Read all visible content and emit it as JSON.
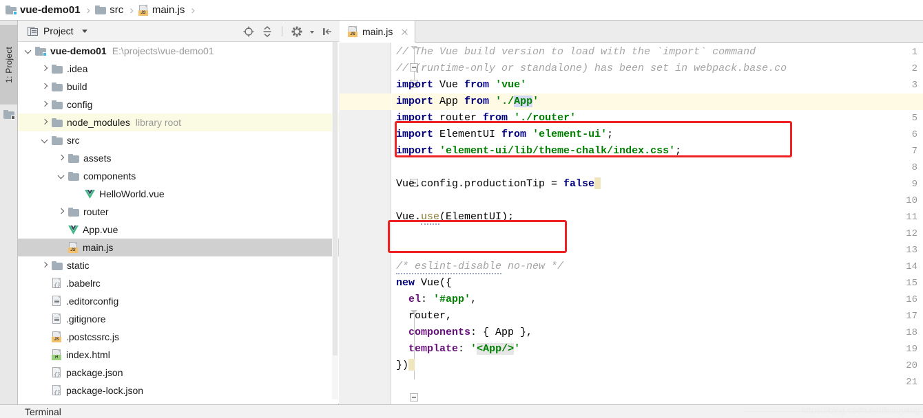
{
  "breadcrumb": {
    "items": [
      {
        "label": "vue-demo01",
        "icon": "module-folder-icon",
        "bold": true
      },
      {
        "label": "src",
        "icon": "folder-icon",
        "bold": false
      },
      {
        "label": "main.js",
        "icon": "js-file-icon",
        "bold": false
      }
    ],
    "separator": "›"
  },
  "tool_strip": {
    "project_tab_label": "1: Project"
  },
  "project_panel": {
    "title": "Project",
    "toolbar": [
      {
        "name": "locate-target-icon",
        "tooltip": "Select Opened File"
      },
      {
        "name": "collapse-all-icon",
        "tooltip": "Collapse All"
      },
      {
        "name": "settings-gear-icon",
        "tooltip": "Settings"
      },
      {
        "name": "hide-panel-icon",
        "tooltip": "Hide"
      }
    ],
    "tree": [
      {
        "label": "vue-demo01",
        "note": "E:\\projects\\vue-demo01",
        "icon": "module-folder-icon",
        "indent": 0,
        "twisty": "down",
        "bold": true,
        "state": "normal"
      },
      {
        "label": ".idea",
        "note": "",
        "icon": "folder-icon",
        "indent": 1,
        "twisty": "right",
        "bold": false,
        "state": "normal"
      },
      {
        "label": "build",
        "note": "",
        "icon": "folder-icon",
        "indent": 1,
        "twisty": "right",
        "bold": false,
        "state": "normal"
      },
      {
        "label": "config",
        "note": "",
        "icon": "folder-icon",
        "indent": 1,
        "twisty": "right",
        "bold": false,
        "state": "normal"
      },
      {
        "label": "node_modules",
        "note": "library root",
        "icon": "folder-icon",
        "indent": 1,
        "twisty": "right",
        "bold": false,
        "state": "library"
      },
      {
        "label": "src",
        "note": "",
        "icon": "folder-icon",
        "indent": 1,
        "twisty": "down",
        "bold": false,
        "state": "normal"
      },
      {
        "label": "assets",
        "note": "",
        "icon": "folder-icon",
        "indent": 2,
        "twisty": "right",
        "bold": false,
        "state": "normal"
      },
      {
        "label": "components",
        "note": "",
        "icon": "folder-icon",
        "indent": 2,
        "twisty": "down",
        "bold": false,
        "state": "normal"
      },
      {
        "label": "HelloWorld.vue",
        "note": "",
        "icon": "vue-file-icon",
        "indent": 3,
        "twisty": "none",
        "bold": false,
        "state": "normal"
      },
      {
        "label": "router",
        "note": "",
        "icon": "folder-icon",
        "indent": 2,
        "twisty": "right",
        "bold": false,
        "state": "normal"
      },
      {
        "label": "App.vue",
        "note": "",
        "icon": "vue-file-icon",
        "indent": 2,
        "twisty": "none",
        "bold": false,
        "state": "normal"
      },
      {
        "label": "main.js",
        "note": "",
        "icon": "js-file-icon",
        "indent": 2,
        "twisty": "none",
        "bold": false,
        "state": "selected"
      },
      {
        "label": "static",
        "note": "",
        "icon": "folder-icon",
        "indent": 1,
        "twisty": "right",
        "bold": false,
        "state": "normal"
      },
      {
        "label": ".babelrc",
        "note": "",
        "icon": "json-file-icon",
        "indent": 1,
        "twisty": "none",
        "bold": false,
        "state": "normal"
      },
      {
        "label": ".editorconfig",
        "note": "",
        "icon": "text-file-icon",
        "indent": 1,
        "twisty": "none",
        "bold": false,
        "state": "normal"
      },
      {
        "label": ".gitignore",
        "note": "",
        "icon": "text-file-icon",
        "indent": 1,
        "twisty": "none",
        "bold": false,
        "state": "normal"
      },
      {
        "label": ".postcssrc.js",
        "note": "",
        "icon": "js-file-icon",
        "indent": 1,
        "twisty": "none",
        "bold": false,
        "state": "normal"
      },
      {
        "label": "index.html",
        "note": "",
        "icon": "html-file-icon",
        "indent": 1,
        "twisty": "none",
        "bold": false,
        "state": "normal"
      },
      {
        "label": "package.json",
        "note": "",
        "icon": "json-file-icon",
        "indent": 1,
        "twisty": "none",
        "bold": false,
        "state": "normal"
      },
      {
        "label": "package-lock.json",
        "note": "",
        "icon": "json-file-icon",
        "indent": 1,
        "twisty": "none",
        "bold": false,
        "state": "normal"
      }
    ]
  },
  "editor": {
    "tab": {
      "label": "main.js",
      "icon": "js-file-icon",
      "close_icon": "close-icon"
    },
    "line_numbers": [
      "1",
      "2",
      "3",
      "4",
      "5",
      "6",
      "7",
      "8",
      "9",
      "10",
      "11",
      "12",
      "13",
      "14",
      "15",
      "16",
      "17",
      "18",
      "19",
      "20",
      "21"
    ],
    "current_line": 4,
    "lines": [
      {
        "n": 1,
        "text": "// The Vue build version to load with the `import` command"
      },
      {
        "n": 2,
        "text": "// (runtime-only or standalone) has been set in webpack.base.co"
      },
      {
        "n": 3,
        "text": "import Vue from 'vue'"
      },
      {
        "n": 4,
        "text": "import App from './App'"
      },
      {
        "n": 5,
        "text": "import router from './router'"
      },
      {
        "n": 6,
        "text": "import ElementUI from 'element-ui';"
      },
      {
        "n": 7,
        "text": "import 'element-ui/lib/theme-chalk/index.css';"
      },
      {
        "n": 8,
        "text": ""
      },
      {
        "n": 9,
        "text": "Vue.config.productionTip = false"
      },
      {
        "n": 10,
        "text": ""
      },
      {
        "n": 11,
        "text": "Vue.use(ElementUI);"
      },
      {
        "n": 12,
        "text": ""
      },
      {
        "n": 13,
        "text": ""
      },
      {
        "n": 14,
        "text": "/* eslint-disable no-new */"
      },
      {
        "n": 15,
        "text": "new Vue({"
      },
      {
        "n": 16,
        "text": "  el: '#app',"
      },
      {
        "n": 17,
        "text": "  router,"
      },
      {
        "n": 18,
        "text": "  components: { App },"
      },
      {
        "n": 19,
        "text": "  template: '<App/>'"
      },
      {
        "n": 20,
        "text": "})"
      },
      {
        "n": 21,
        "text": ""
      }
    ],
    "annotations": [
      {
        "name": "element-ui-import-highlight",
        "lines": "6-7",
        "color": "#ee2222"
      },
      {
        "name": "vue-use-highlight",
        "lines": "11",
        "color": "#ee2222"
      }
    ],
    "colors": {
      "keyword": "#000080",
      "string": "#008000",
      "comment": "#a5a5a5",
      "property": "#660e7a",
      "current_line_bg": "#fffae3",
      "annotation_red": "#ee2222"
    }
  },
  "status_bar": {
    "terminal_label": "Terminal",
    "watermark": "https://blog.csdn.net/liiiliuyang"
  }
}
